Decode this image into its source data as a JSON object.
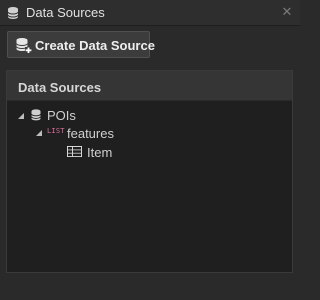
{
  "window": {
    "title": "Data Sources",
    "close_glyph": "✕"
  },
  "toolbar": {
    "create_label": "Create Data Source",
    "create_icon": "database-add-icon"
  },
  "panel": {
    "header": "Data Sources"
  },
  "tree": {
    "nodes": [
      {
        "label": "POIs",
        "icon": "database-icon",
        "expanded": true
      },
      {
        "label": "features",
        "badge": "LIST",
        "icon": "list-badge-icon",
        "expanded": true
      },
      {
        "label": "Item",
        "icon": "item-icon"
      }
    ]
  },
  "colors": {
    "background": "#2a2a2a",
    "panel": "#1f1f1f",
    "list_badge": "#e06d9a"
  }
}
